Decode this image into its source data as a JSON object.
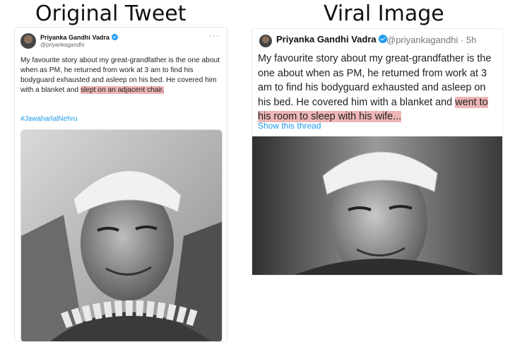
{
  "headings": {
    "left": "Original Tweet",
    "right": "Viral Image"
  },
  "original_tweet": {
    "name": "Priyanka Gandhi Vadra",
    "handle": "@priyankagandhi",
    "more": "···",
    "text_part1": "My favourite story about my great-grandfather is the one about when as PM, he returned from work at 3 am to find his bodyguard exhausted and asleep on his bed. He covered him with a blanket and ",
    "text_highlight": "slept on an adjacent chair.",
    "hashtag": "#JawaharlalNehru",
    "highlight_color": "#d65a5a"
  },
  "viral_tweet": {
    "name": "Priyanka Gandhi Vadra",
    "handle": "@priyankagandhi · 5h",
    "text_part1": "My favourite story about my great-grandfather is the one about when as PM, he returned from work at 3 am to find his bodyguard exhausted and asleep on his bed. He covered him with a blanket and ",
    "text_highlight": "went to his room to sleep with his wife...",
    "show_thread": "Show this thread",
    "link_color": "#1d9bf0"
  }
}
